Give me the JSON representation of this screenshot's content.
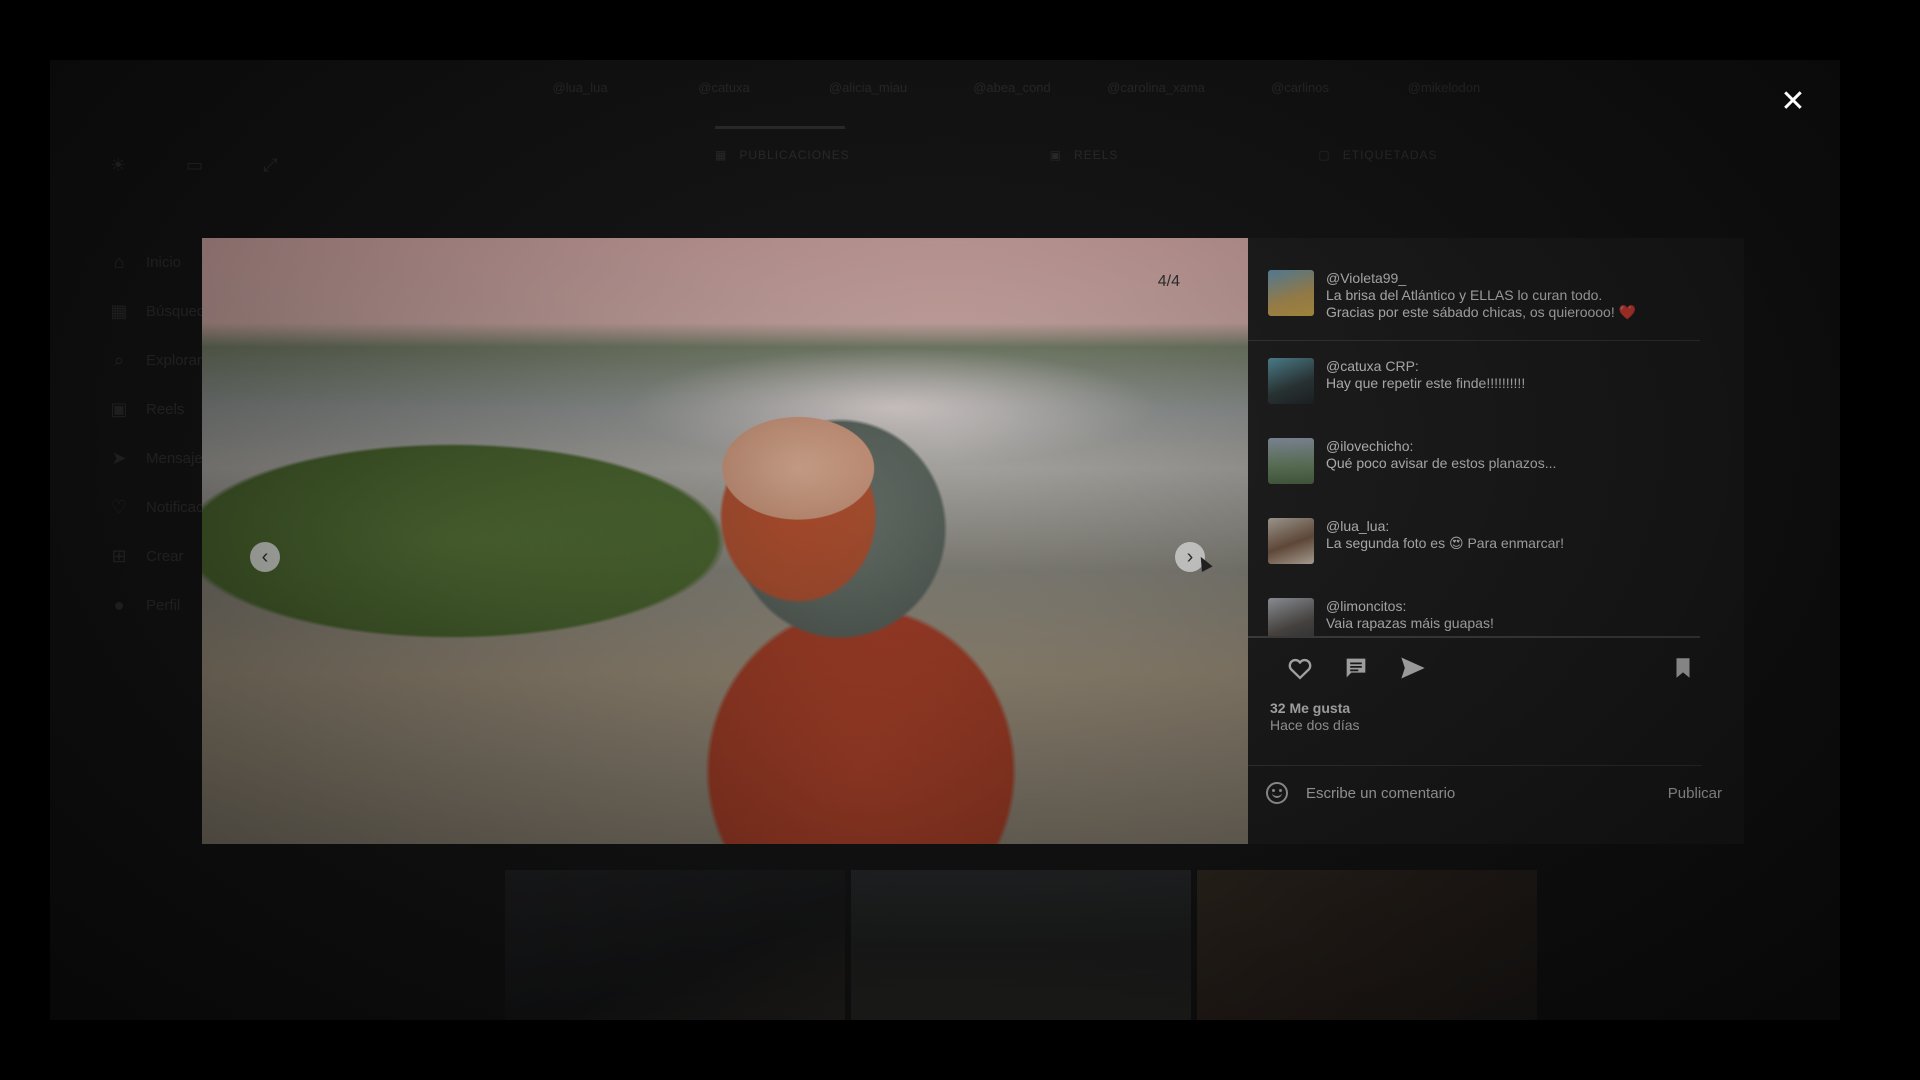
{
  "stories": [
    "@lua_lua",
    "@catuxa",
    "@alicia_miau",
    "@abea_cond",
    "@carolina_xama",
    "@carlinos",
    "@mikelodon"
  ],
  "profile_tabs": [
    "PUBLICACIONES",
    "REELS",
    "ETIQUETADAS"
  ],
  "sidebar": {
    "items": [
      {
        "label": "Inicio",
        "icon": "home-icon"
      },
      {
        "label": "Búsqueda",
        "icon": "grid-icon"
      },
      {
        "label": "Explorar",
        "icon": "search-icon"
      },
      {
        "label": "Reels",
        "icon": "reels-icon"
      },
      {
        "label": "Mensajes",
        "icon": "send-icon"
      },
      {
        "label": "Notificaciones",
        "icon": "heart-icon"
      },
      {
        "label": "Crear",
        "icon": "plus-icon"
      },
      {
        "label": "Perfil",
        "icon": "user-icon"
      }
    ]
  },
  "post": {
    "counter": "4/4",
    "prev_glyph": "‹",
    "next_glyph": "›"
  },
  "comments": [
    {
      "user": "@Violeta99_",
      "text": "La brisa del Atlántico y ELLAS lo curan todo.\nGracias por este sábado chicas, os quieroooo! ❤️"
    },
    {
      "user": "@catuxa CRP:",
      "text": "Hay que repetir este finde!!!!!!!!!!"
    },
    {
      "user": "@ilovechicho:",
      "text": "Qué poco avisar de estos planazos..."
    },
    {
      "user": "@lua_lua:",
      "text": "La segunda foto es 😍 Para enmarcar!"
    },
    {
      "user": "@limoncitos:",
      "text": "Vaia rapazas máis guapas!"
    }
  ],
  "likes": "32 Me gusta",
  "time": "Hace dos días",
  "comment_box": {
    "placeholder": "Escribe un comentario",
    "publish_label": "Publicar"
  },
  "close_glyph": "✕",
  "colors": {
    "panel_bg": "#1c1c1c",
    "text": "#e6e6e6",
    "like_heart": "#e0245e"
  }
}
